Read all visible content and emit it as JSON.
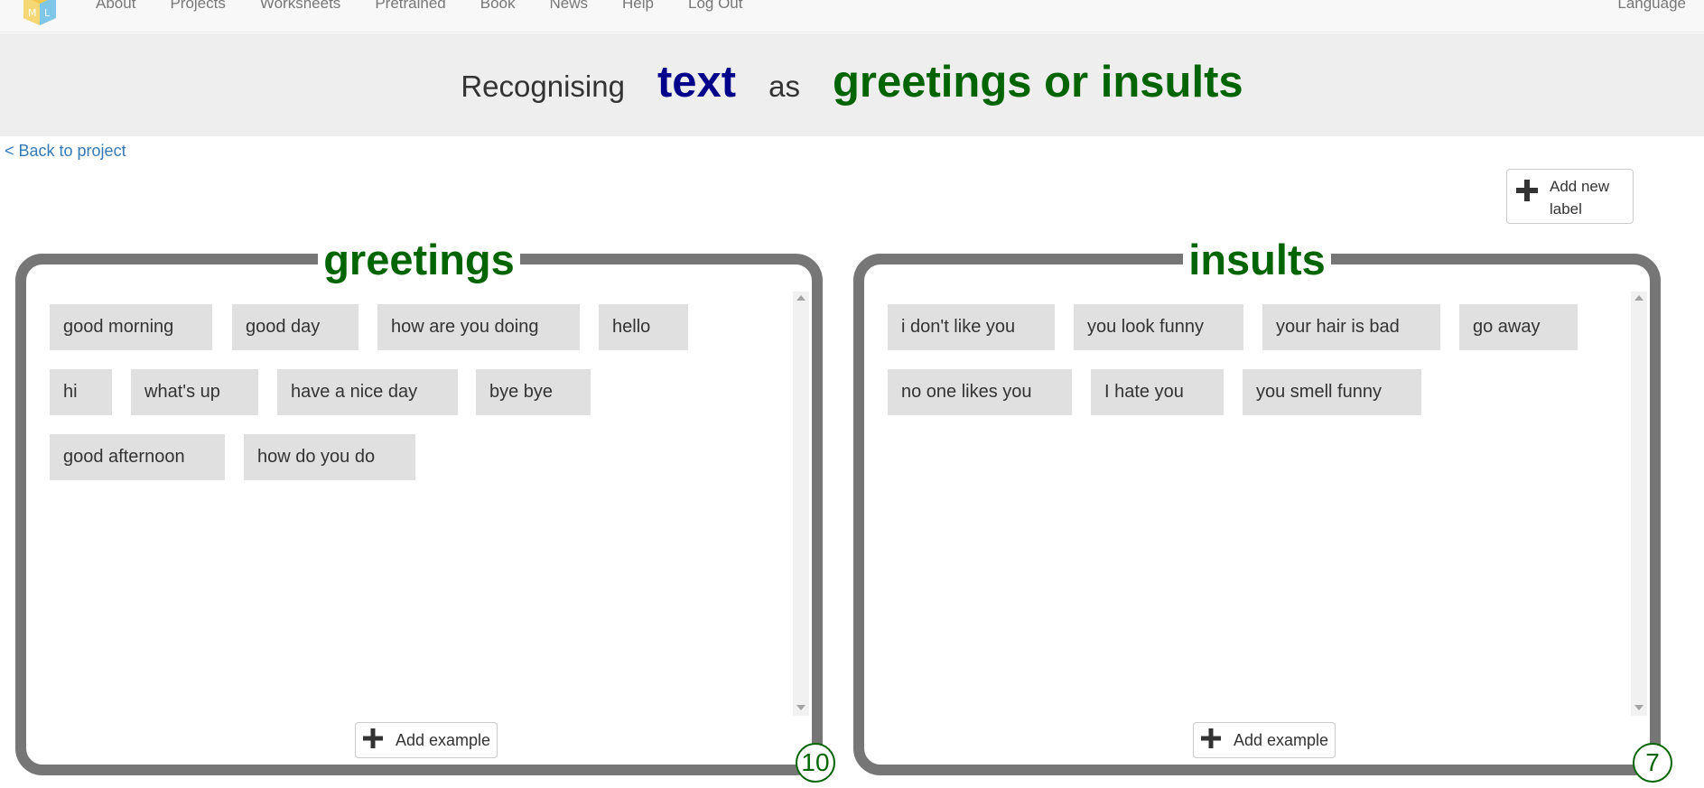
{
  "nav": {
    "links": [
      "About",
      "Projects",
      "Worksheets",
      "Pretrained",
      "Book",
      "News",
      "Help",
      "Log Out"
    ],
    "language": "Language"
  },
  "banner": {
    "recognising": "Recognising",
    "type": "text",
    "as": "as",
    "project": "greetings or insults"
  },
  "back_link": "< Back to project",
  "add_label_button": "Add new label",
  "labels": [
    {
      "name": "greetings",
      "count": "10",
      "add_example": "Add example",
      "examples": [
        "good morning",
        "good day",
        "how are you doing",
        "hello",
        "hi",
        "what's up",
        "have a nice day",
        "bye bye",
        "good afternoon",
        "how do you do"
      ]
    },
    {
      "name": "insults",
      "count": "7",
      "add_example": "Add example",
      "examples": [
        "i don't like you",
        "you look funny",
        "your hair is bad",
        "go away",
        "no one likes you",
        "I hate you",
        "you smell funny"
      ]
    }
  ],
  "colors": {
    "type_color": "#00008b",
    "label_color": "#006400",
    "panel_border": "#767676",
    "example_bg": "#e0e0e0",
    "link_color": "#337ab7"
  }
}
